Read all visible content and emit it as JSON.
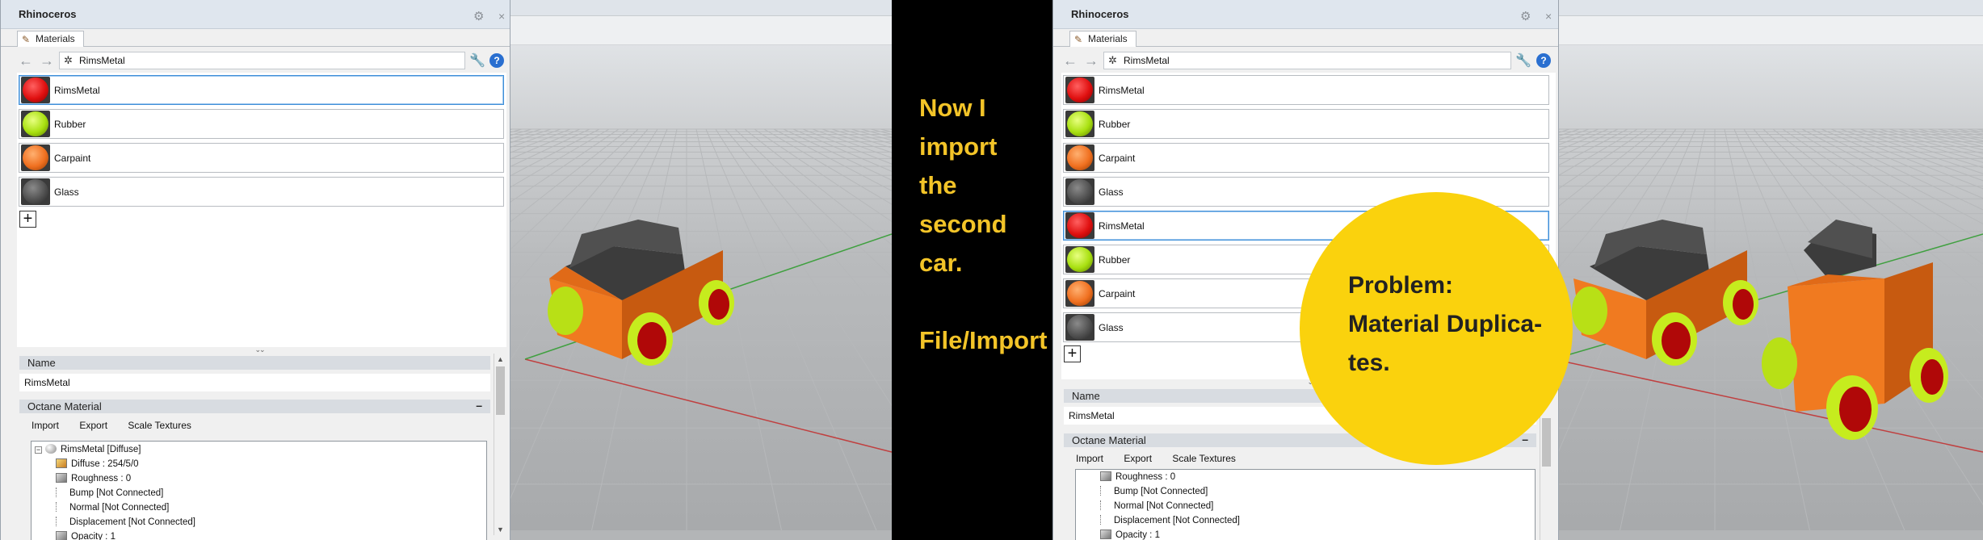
{
  "left": {
    "panel": {
      "title": "Rhinoceros",
      "tab": "Materials",
      "path": "RimsMetal",
      "materials": [
        {
          "name": "RimsMetal",
          "color": "#e01010",
          "selected": true
        },
        {
          "name": "Rubber",
          "color": "#a8e010",
          "selected": false
        },
        {
          "name": "Carpaint",
          "color": "#f07020",
          "selected": false
        },
        {
          "name": "Glass",
          "color": "#505050",
          "selected": false
        }
      ],
      "add_symbol": "+",
      "name_header": "Name",
      "name_value": "RimsMetal",
      "octane_header": "Octane Material",
      "collapse_symbol": "–",
      "buttons": [
        "Import",
        "Export",
        "Scale Textures"
      ],
      "tree": [
        "RimsMetal  [Diffuse]",
        "Diffuse : 254/5/0",
        "Roughness : 0",
        "Bump  [Not Connected]",
        "Normal  [Not Connected]",
        "Displacement  [Not Connected]",
        "Opacity : 1"
      ]
    }
  },
  "middle": {
    "lines": [
      "Now I",
      "import",
      "the",
      "second",
      "car.",
      "",
      "File/Import"
    ],
    "color": "#f3c428"
  },
  "right": {
    "panel": {
      "title": "Rhinoceros",
      "tab": "Materials",
      "path": "RimsMetal",
      "materials": [
        {
          "name": "RimsMetal",
          "color": "#e01010",
          "selected": false
        },
        {
          "name": "Rubber",
          "color": "#a8e010",
          "selected": false
        },
        {
          "name": "Carpaint",
          "color": "#f07020",
          "selected": false
        },
        {
          "name": "Glass",
          "color": "#505050",
          "selected": false
        },
        {
          "name": "RimsMetal",
          "color": "#e01010",
          "selected": true
        },
        {
          "name": "Rubber",
          "color": "#a8e010",
          "selected": false
        },
        {
          "name": "Carpaint",
          "color": "#f07020",
          "selected": false
        },
        {
          "name": "Glass",
          "color": "#505050",
          "selected": false
        }
      ],
      "add_symbol": "+",
      "name_header": "Name",
      "name_value": "RimsMetal",
      "octane_header": "Octane Material",
      "collapse_symbol": "–",
      "buttons": [
        "Import",
        "Export",
        "Scale Textures"
      ],
      "tree": [
        "Roughness : 0",
        "Bump  [Not Connected]",
        "Normal  [Not Connected]",
        "Displacement  [Not Connected]",
        "Opacity : 1"
      ]
    },
    "callout": {
      "lines": [
        "Problem:",
        "Material Duplica-",
        "tes."
      ],
      "color": "#fad20d"
    }
  }
}
